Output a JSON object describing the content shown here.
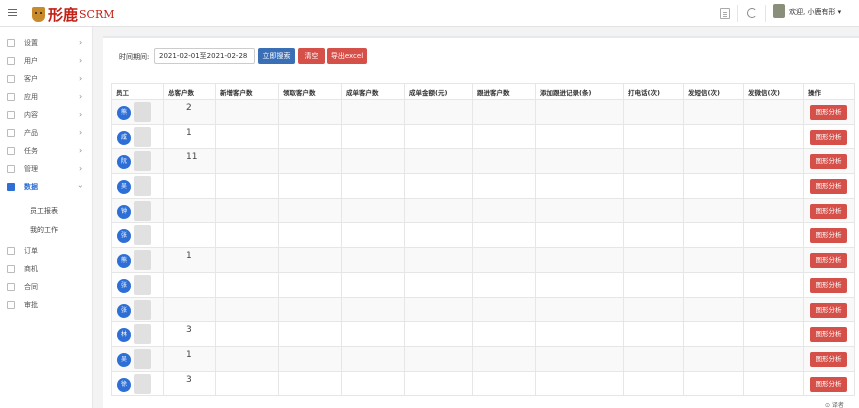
{
  "header": {
    "logo_cn": "形鹿",
    "logo_en": "SCRM",
    "welcome": "欢迎, 小鹿有形 ▾"
  },
  "sidebar": {
    "items": [
      {
        "label": "设置",
        "icon": "gear-icon",
        "arrow": "›"
      },
      {
        "label": "用户",
        "icon": "user-icon",
        "arrow": "›"
      },
      {
        "label": "客户",
        "icon": "monitor-icon",
        "arrow": "›"
      },
      {
        "label": "应用",
        "icon": "cart-icon",
        "arrow": "›"
      },
      {
        "label": "内容",
        "icon": "list-icon",
        "arrow": "›"
      },
      {
        "label": "产品",
        "icon": "tag-icon",
        "arrow": "›"
      },
      {
        "label": "任务",
        "icon": "flag-icon",
        "arrow": "›"
      },
      {
        "label": "管理",
        "icon": "settings-icon",
        "arrow": "›"
      },
      {
        "label": "数据",
        "icon": "database-icon",
        "arrow": "›"
      }
    ],
    "sub_items": [
      "员工报表",
      "我的工作"
    ],
    "bottom_items": [
      {
        "label": "订单",
        "icon": "order-icon"
      },
      {
        "label": "商机",
        "icon": "opportunity-icon"
      },
      {
        "label": "合同",
        "icon": "contract-icon"
      },
      {
        "label": "审批",
        "icon": "approval-icon"
      }
    ]
  },
  "filter": {
    "label": "时间期间:",
    "date_range": "2021-02-01至2021-02-28",
    "search_button": "立即搜索",
    "clear_button": "清空",
    "export_button": "导出excel"
  },
  "table": {
    "headers": [
      "员工",
      "总客户数",
      "新增客户数",
      "领取客户数",
      "成单客户数",
      "成单金额(元)",
      "跟进客户数",
      "添加跟进记录(条)",
      "打电话(次)",
      "发短信(次)",
      "发微信(次)",
      "操作"
    ],
    "rows": [
      {
        "initial": "熊",
        "total": "2"
      },
      {
        "initial": "咸",
        "total": "1"
      },
      {
        "initial": "阮",
        "total": "11"
      },
      {
        "initial": "吴",
        "total": ""
      },
      {
        "initial": "钟",
        "total": ""
      },
      {
        "initial": "张",
        "total": ""
      },
      {
        "initial": "熊",
        "total": "1"
      },
      {
        "initial": "张",
        "total": ""
      },
      {
        "initial": "张",
        "total": ""
      },
      {
        "initial": "林",
        "total": "3"
      },
      {
        "initial": "吴",
        "total": "1"
      },
      {
        "initial": "徐",
        "total": "3"
      }
    ],
    "action_label": "图形分析"
  },
  "footer": {
    "note": "⊙ 译者"
  },
  "colors": {
    "primary": "#3a6fb6",
    "danger": "#d6504a",
    "avatar_blue": "#2d6fd6",
    "brand_red": "#c21f16"
  }
}
